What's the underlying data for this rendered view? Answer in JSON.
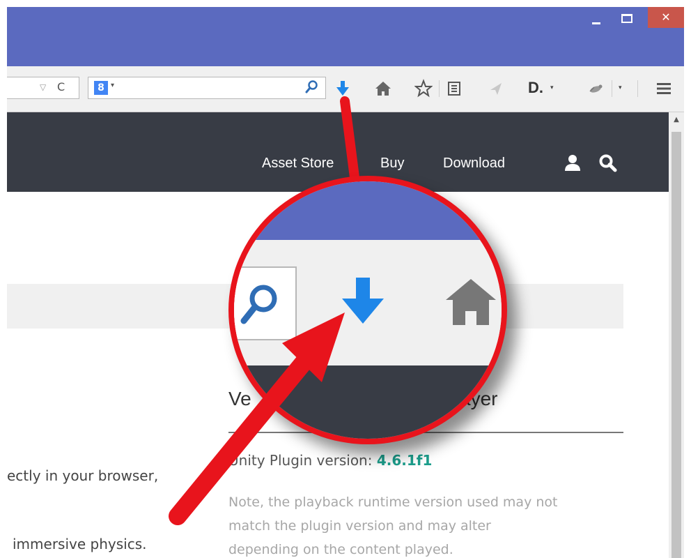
{
  "window": {
    "close_glyph": "✕"
  },
  "toolbar": {
    "url_dropdown_glyph": "▽",
    "reload_glyph": "C",
    "search_engine_logo": "8",
    "search_engine_caret": "▾",
    "extension_text": "D.",
    "extension_caret": "▾",
    "overflow_caret": "▾",
    "icons": [
      "search-icon",
      "download-icon",
      "home-icon",
      "star-icon",
      "reading-list-icon",
      "send-icon",
      "bird-icon",
      "menu-icon"
    ]
  },
  "site_nav": {
    "items": [
      "Asset Store",
      "Buy",
      "Download"
    ],
    "icons": [
      "user-icon",
      "search-icon"
    ]
  },
  "sidebar_panel": {
    "heading_start": "Ve",
    "heading_end": "ayer",
    "plugin_label": "Unity Plugin version: ",
    "plugin_version": "4.6.1f1",
    "note_lines": [
      "Note, the playback runtime version used may not",
      "match the plugin version and may alter",
      "depending on the content played."
    ]
  },
  "main_text": {
    "line1": "ectly in your browser,",
    "line2": "immersive physics."
  },
  "colors": {
    "title_bar": "#5b6abf",
    "header": "#383c45",
    "download_arrow": "#1e86e8",
    "annotation_red": "#e8141c",
    "version_accent": "#1c9e8c"
  }
}
